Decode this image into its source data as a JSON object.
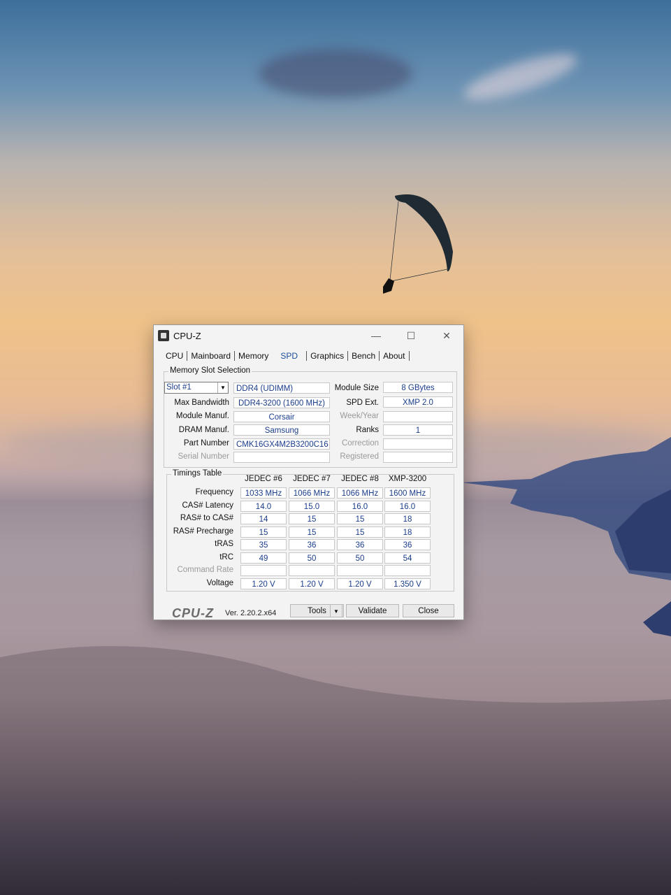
{
  "window": {
    "title": "CPU-Z",
    "minimize": "—",
    "maximize": "☐",
    "close": "✕"
  },
  "tabs": [
    "CPU",
    "Mainboard",
    "Memory",
    "SPD",
    "Graphics",
    "Bench",
    "About"
  ],
  "active_tab": "SPD",
  "slot_group": {
    "label": "Memory Slot Selection",
    "slot": "Slot #1",
    "type": "DDR4 (UDIMM)",
    "module_size_label": "Module Size",
    "module_size": "8 GBytes",
    "max_bw_label": "Max Bandwidth",
    "max_bw": "DDR4-3200 (1600 MHz)",
    "spd_ext_label": "SPD Ext.",
    "spd_ext": "XMP 2.0",
    "manuf_label": "Module Manuf.",
    "manuf": "Corsair",
    "week_label": "Week/Year",
    "week": "",
    "dram_label": "DRAM Manuf.",
    "dram": "Samsung",
    "ranks_label": "Ranks",
    "ranks": "1",
    "part_label": "Part Number",
    "part": "CMK16GX4M2B3200C16",
    "correction_label": "Correction",
    "correction": "",
    "serial_label": "Serial Number",
    "serial": "",
    "registered_label": "Registered",
    "registered": ""
  },
  "timings": {
    "label": "Timings Table",
    "columns": [
      "JEDEC #6",
      "JEDEC #7",
      "JEDEC #8",
      "XMP-3200"
    ],
    "rows": [
      {
        "label": "Frequency",
        "values": [
          "1033 MHz",
          "1066 MHz",
          "1066 MHz",
          "1600 MHz"
        ],
        "dim": false
      },
      {
        "label": "CAS# Latency",
        "values": [
          "14.0",
          "15.0",
          "16.0",
          "16.0"
        ],
        "dim": false
      },
      {
        "label": "RAS# to CAS#",
        "values": [
          "14",
          "15",
          "15",
          "18"
        ],
        "dim": false
      },
      {
        "label": "RAS# Precharge",
        "values": [
          "15",
          "15",
          "15",
          "18"
        ],
        "dim": false
      },
      {
        "label": "tRAS",
        "values": [
          "35",
          "36",
          "36",
          "36"
        ],
        "dim": false
      },
      {
        "label": "tRC",
        "values": [
          "49",
          "50",
          "50",
          "54"
        ],
        "dim": false
      },
      {
        "label": "Command Rate",
        "values": [
          "",
          "",
          "",
          ""
        ],
        "dim": true
      },
      {
        "label": "Voltage",
        "values": [
          "1.20 V",
          "1.20 V",
          "1.20 V",
          "1.350 V"
        ],
        "dim": false
      }
    ]
  },
  "footer": {
    "logo": "CPU-Z",
    "version": "Ver. 2.20.2.x64",
    "tools": "Tools",
    "tools_arrow": "▼",
    "validate": "Validate",
    "close": "Close"
  }
}
